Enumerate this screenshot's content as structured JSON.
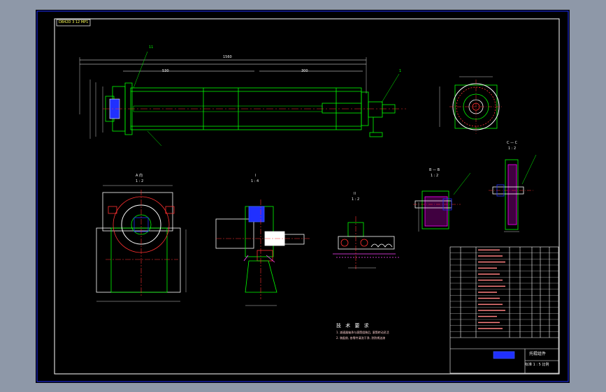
{
  "drawing": {
    "title_box": "DB42D 3 12 MP1",
    "labels": {
      "main_length": "1560",
      "balloon_11": "11",
      "balloon_1": "1",
      "view_aa": "A 向",
      "view_aa_scale": "1 : 2",
      "view_i": "I",
      "view_i_scale": "1 : 4",
      "view_ii": "II",
      "view_ii_scale": "1 : 2",
      "view_bb": "B — B",
      "view_bb_scale": "1 : 2",
      "view_cc": "C — C",
      "view_cc_scale": "1 : 2",
      "dim_530": "530",
      "dim_300": "300"
    },
    "notes": {
      "title": "技 术 要 求",
      "line1": "1. 减速器轴承与滚筒组装后, 滚筒转动灵活",
      "line2": "2. 装配前, 各零件清洗干净, 涂防锈油漆"
    },
    "title_block": {
      "name": "托辊组件",
      "footer": "标准 1 : 5  比例",
      "rows": 15
    },
    "colors": {
      "background": "#000000",
      "frame": "#ffffff",
      "part_lines": "#00ff00",
      "dimensions": "#ff4040",
      "hatching": "#ff00ff",
      "accent": "#4060ff",
      "highlight": "#ffff55"
    }
  }
}
